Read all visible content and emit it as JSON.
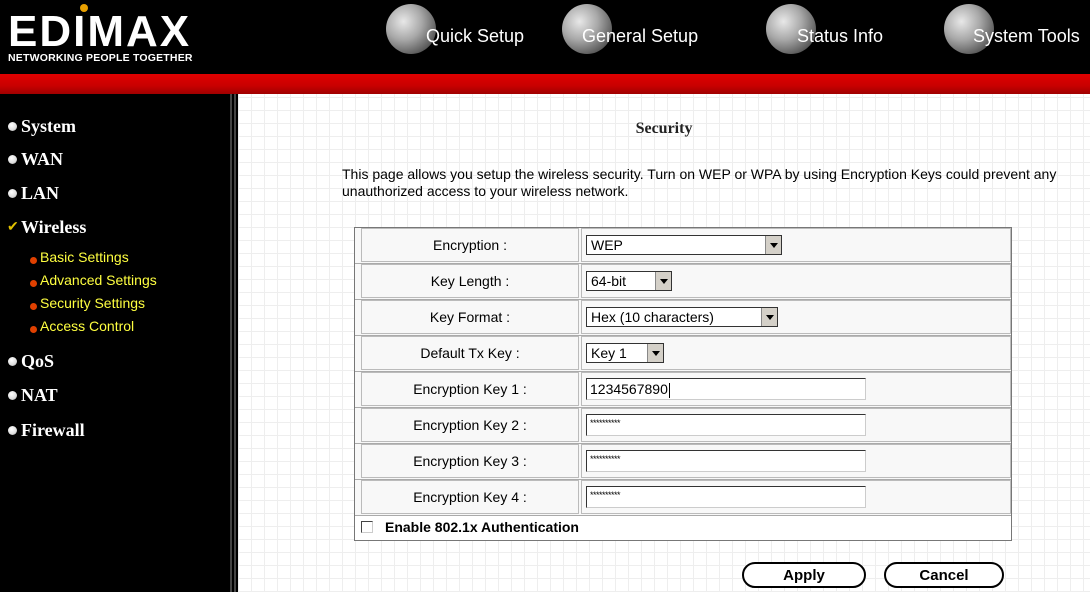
{
  "brand": {
    "logo_text": "EDIMAX",
    "tagline": "NETWORKING PEOPLE TOGETHER"
  },
  "top_nav": [
    {
      "label": "Quick Setup"
    },
    {
      "label": "General Setup"
    },
    {
      "label": "Status Info"
    },
    {
      "label": "System Tools"
    }
  ],
  "sidebar": {
    "items": [
      {
        "label": "System"
      },
      {
        "label": "WAN"
      },
      {
        "label": "LAN"
      },
      {
        "label": "Wireless",
        "expanded": true
      },
      {
        "label": "QoS"
      },
      {
        "label": "NAT"
      },
      {
        "label": "Firewall"
      }
    ],
    "wireless_sub": [
      {
        "label": "Basic Settings"
      },
      {
        "label": "Advanced Settings"
      },
      {
        "label": "Security Settings",
        "active": true
      },
      {
        "label": "Access Control"
      }
    ]
  },
  "page": {
    "title": "Security",
    "description": "This page allows you setup the wireless security. Turn on WEP or WPA by using Encryption Keys could prevent any unauthorized access to your wireless network."
  },
  "form": {
    "encryption": {
      "label": "Encryption :",
      "value": "WEP"
    },
    "key_length": {
      "label": "Key Length :",
      "value": "64-bit"
    },
    "key_format": {
      "label": "Key Format :",
      "value": "Hex (10 characters)"
    },
    "default_tx_key": {
      "label": "Default Tx Key :",
      "value": "Key 1"
    },
    "key1": {
      "label": "Encryption Key 1 :",
      "value": "1234567890"
    },
    "key2": {
      "label": "Encryption Key 2 :",
      "value": "**********"
    },
    "key3": {
      "label": "Encryption Key 3 :",
      "value": "**********"
    },
    "key4": {
      "label": "Encryption Key 4 :",
      "value": "**********"
    },
    "enable_8021x": {
      "label": "Enable 802.1x Authentication",
      "checked": false
    }
  },
  "buttons": {
    "apply": "Apply",
    "cancel": "Cancel"
  },
  "colors": {
    "header_bg": "#000000",
    "red_band": "#d00000",
    "sub_menu_text": "#ffff40",
    "sub_menu_dot": "#e04000"
  }
}
